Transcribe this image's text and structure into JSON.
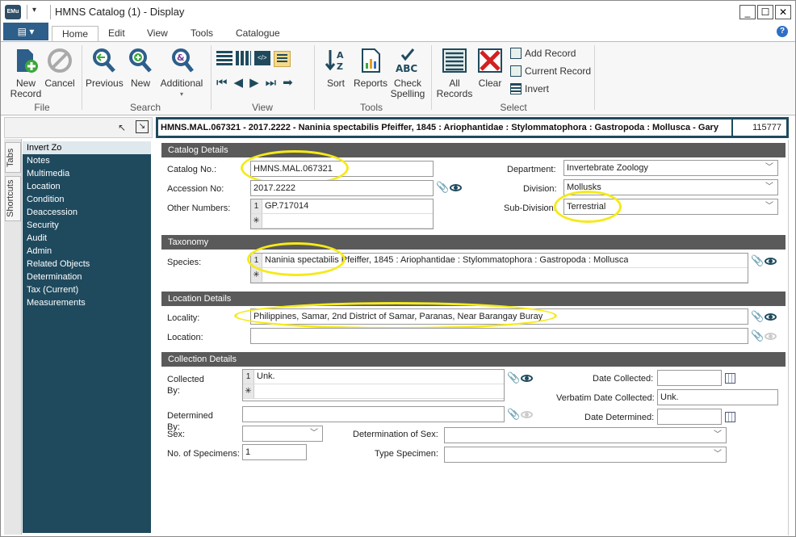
{
  "window": {
    "title": "HMNS Catalog (1) - Display",
    "logo_text": "EMu",
    "minimize": "_",
    "maximize": "☐",
    "close": "✕"
  },
  "ribbon": {
    "file_menu": "▤ ▾",
    "tabs": [
      "Home",
      "Edit",
      "View",
      "Tools",
      "Catalogue"
    ],
    "groups": {
      "file": {
        "label": "File",
        "new_record": "New Record",
        "cancel": "Cancel"
      },
      "search": {
        "label": "Search",
        "previous": "Previous",
        "new": "New",
        "additional": "Additional"
      },
      "view": {
        "label": "View"
      },
      "tools": {
        "label": "Tools",
        "sort": "Sort",
        "reports": "Reports",
        "check_spelling": "Check Spelling"
      },
      "select": {
        "label": "Select",
        "all_records": "All Records",
        "clear": "Clear",
        "add_record": "Add Record",
        "current_record": "Current Record",
        "invert": "Invert"
      }
    }
  },
  "record": {
    "summary": "HMNS.MAL.067321 - 2017.2222 - Naninia spectabilis Pfeiffer, 1845 : Ariophantidae : Stylommatophora : Gastropoda : Mollusca - Gary",
    "irn": "115777"
  },
  "side_tabs": [
    "Tabs",
    "Shortcuts"
  ],
  "tab_list": [
    "Invert Zo",
    "Notes",
    "Multimedia",
    "Location",
    "Condition",
    "Deaccession",
    "Security",
    "Audit",
    "Admin",
    "Related Objects",
    "Determination",
    "Tax (Current)",
    "Measurements"
  ],
  "catalog_details": {
    "heading": "Catalog Details",
    "catalog_no_label": "Catalog No.:",
    "catalog_no": "HMNS.MAL.067321",
    "accession_label": "Accession No:",
    "accession_no": "2017.2222",
    "other_numbers_label": "Other Numbers:",
    "other_numbers": [
      "GP.717014"
    ],
    "department_label": "Department:",
    "department": "Invertebrate Zoology",
    "division_label": "Division:",
    "division": "Mollusks",
    "subdivision_label": "Sub-Division:",
    "subdivision": "Terrestrial"
  },
  "taxonomy": {
    "heading": "Taxonomy",
    "species_label": "Species:",
    "species": "Naninia spectabilis Pfeiffer, 1845 : Ariophantidae : Stylommatophora : Gastropoda : Mollusca"
  },
  "location_details": {
    "heading": "Location Details",
    "locality_label": "Locality:",
    "locality": "Philippines, Samar, 2nd District of Samar, Paranas, Near Barangay Buray",
    "location_label": "Location:",
    "location": ""
  },
  "collection_details": {
    "heading": "Collection Details",
    "collected_by_label": "Collected By:",
    "collected_by": [
      "Unk."
    ],
    "date_collected_label": "Date Collected:",
    "date_collected": "",
    "verbatim_date_label": "Verbatim Date Collected:",
    "verbatim_date": "Unk.",
    "determined_by_label": "Determined By:",
    "determined_by": "",
    "date_determined_label": "Date Determined:",
    "date_determined": "",
    "sex_label": "Sex:",
    "sex": "",
    "determination_of_sex_label": "Determination of Sex:",
    "determination_of_sex": "",
    "no_specimens_label": "No. of Specimens:",
    "no_specimens": "1",
    "type_specimen_label": "Type Specimen:",
    "type_specimen": ""
  },
  "accent_colors": {
    "panel": "#1f4a5e",
    "section_header": "#5a5a5a",
    "highlight": "#f5ea1a"
  },
  "icons": [
    "new-record-icon",
    "cancel-icon",
    "previous-icon",
    "new-search-icon",
    "additional-icon",
    "sort-icon",
    "reports-icon",
    "check-spelling-icon",
    "all-records-icon",
    "clear-icon",
    "paperclip-icon",
    "eye-icon",
    "calendar-icon",
    "chevron-down-icon",
    "help-icon"
  ]
}
